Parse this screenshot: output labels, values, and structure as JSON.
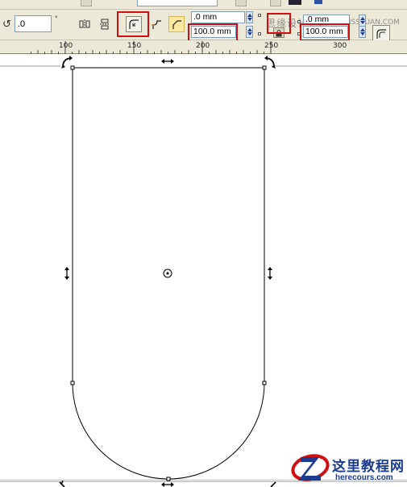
{
  "property_bar": {
    "angle_value": ".0",
    "angle_unit": "°",
    "corner_size_top": ".0 mm",
    "corner_size_top_value": "100.0 mm",
    "corner_size_right": ".0 mm",
    "corner_size_right_value": "100.0 mm"
  },
  "watermark": {
    "text": "思缘设计论坛",
    "url": "www.MISSYUAN.COM"
  },
  "ruler": {
    "labels": [
      "100",
      "150",
      "200",
      "250",
      "300"
    ]
  },
  "logo": {
    "title": "这里教程网",
    "url": "herecours.com"
  },
  "colors": {
    "highlight": "#d01010",
    "toolbar_bg": "#ece9d8",
    "logo_blue": "#1b3c8f",
    "logo_red": "#d01010"
  }
}
